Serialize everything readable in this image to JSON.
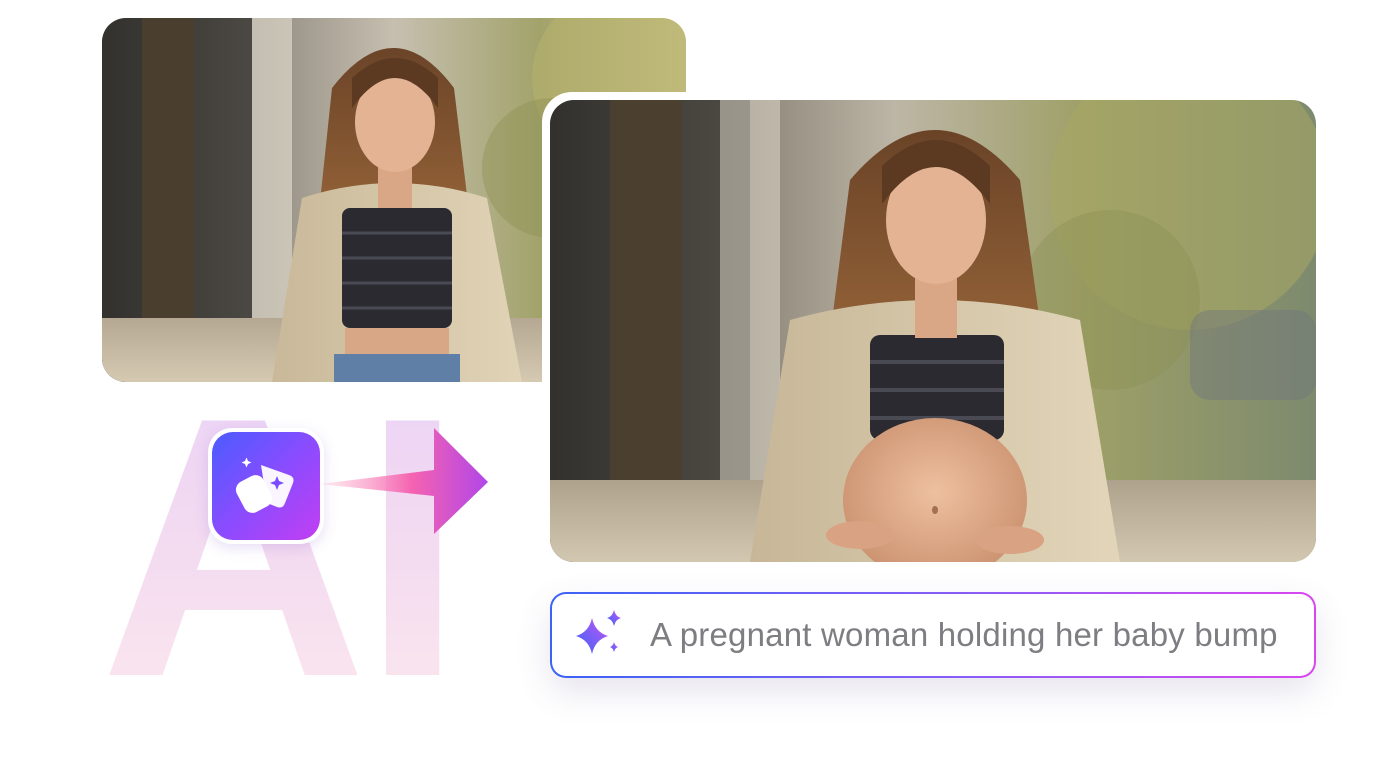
{
  "watermark": {
    "text": "AI"
  },
  "original_photo": {
    "description_icon": "photo-icon"
  },
  "result_photo": {
    "description_icon": "photo-icon"
  },
  "app_icon": {
    "icon": "ai-magic-eraser-icon"
  },
  "arrow": {
    "icon": "arrow-right-icon"
  },
  "prompt": {
    "icon": "sparkle-icon",
    "text": "A pregnant woman holding her baby bump"
  },
  "colors": {
    "accent_blue": "#3b63f5",
    "accent_purple": "#8b5cf6",
    "accent_pink": "#d946ef",
    "prompt_text": "#7d7d82"
  }
}
